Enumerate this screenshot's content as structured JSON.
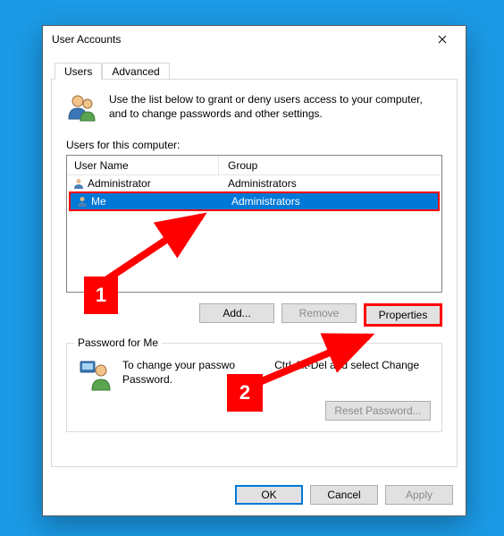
{
  "window": {
    "title": "User Accounts"
  },
  "tabs": {
    "users": "Users",
    "advanced": "Advanced"
  },
  "intro": "Use the list below to grant or deny users access to your computer, and to change passwords and other settings.",
  "list_label": "Users for this computer:",
  "columns": {
    "user_name": "User Name",
    "group": "Group"
  },
  "rows": [
    {
      "name": "Administrator",
      "group": "Administrators",
      "selected": false
    },
    {
      "name": "Me",
      "group": "Administrators",
      "selected": true
    }
  ],
  "buttons": {
    "add": "Add...",
    "remove": "Remove",
    "properties": "Properties"
  },
  "password_box": {
    "title": "Password for Me",
    "text_pre": "To change your passwo",
    "text_post": "Ctrl-Alt-Del and select Change Password.",
    "reset": "Reset Password..."
  },
  "dialog": {
    "ok": "OK",
    "cancel": "Cancel",
    "apply": "Apply"
  },
  "annotations": {
    "m1": "1",
    "m2": "2"
  }
}
